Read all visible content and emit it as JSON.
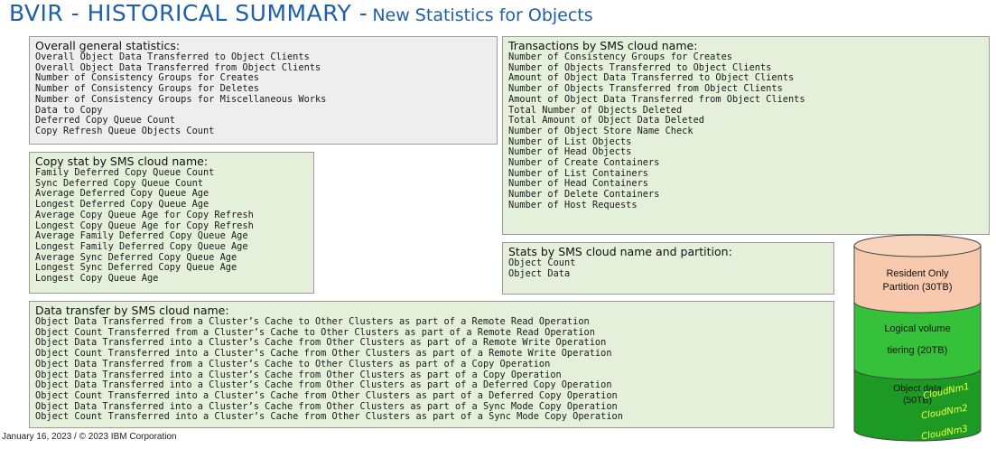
{
  "title": {
    "main": "BVIR - HISTORICAL SUMMARY -",
    "sub": "New Statistics for Objects"
  },
  "overall": {
    "heading": "Overall general statistics:",
    "items": [
      "Overall Object Data Transferred to Object Clients",
      "Overall Object Data Transferred from Object Clients",
      "Number of Consistency Groups for Creates",
      "Number of Consistency Groups for Deletes",
      "Number of Consistency Groups for Miscellaneous Works",
      "Data to Copy",
      "Deferred Copy Queue Count",
      "Copy Refresh Queue Objects Count"
    ]
  },
  "copy_stat": {
    "heading": "Copy stat by SMS cloud name:",
    "items": [
      "Family Deferred Copy Queue Count",
      "Sync Deferred Copy Queue Count",
      "Average Deferred Copy Queue Age",
      "Longest Deferred Copy Queue Age",
      "Average Copy Queue Age for Copy Refresh",
      "Longest Copy Queue Age for Copy Refresh",
      "Average Family Deferred Copy Queue Age",
      "Longest Family Deferred Copy Queue Age",
      "Average Sync Deferred Copy Queue Age",
      "Longest Sync Deferred Copy Queue Age",
      "Longest Copy Queue Age"
    ]
  },
  "transactions": {
    "heading": "Transactions by SMS cloud name:",
    "items": [
      "Number of Consistency Groups for Creates",
      "Number of Objects Transferred to Object Clients",
      "Amount of Object Data Transferred to Object Clients",
      "Number of Objects Transferred from Object Clients",
      "Amount of Object Data Transferred from Object Clients",
      "Total Number of Objects Deleted",
      "Total Amount of Object Data Deleted",
      "Number of Object Store Name Check",
      "Number of List Objects",
      "Number of Head Objects",
      "Number of Create Containers",
      "Number of List Containers",
      "Number of Head Containers",
      "Number of Delete Containers",
      "Number of Host Requests"
    ]
  },
  "partition_stats": {
    "heading": "Stats by SMS cloud name and partition:",
    "items": [
      "Object Count",
      "Object Data"
    ]
  },
  "data_transfer": {
    "heading": "Data transfer by SMS cloud name:",
    "items": [
      "Object Data Transferred from a Cluster’s Cache to Other Clusters as part of a Remote Read Operation",
      "Object Count Transferred from a Cluster’s Cache to Other Clusters as part of a Remote Read Operation",
      "Object Data Transferred into a Cluster’s Cache from Other Clusters as part of a Remote Write Operation",
      "Object Count Transferred into a Cluster’s Cache from Other Clusters as part of a Remote Write Operation",
      "Object Data Transferred from a Cluster’s Cache to Other Clusters as part of a Copy Operation",
      "Object Data Transferred into a Cluster’s Cache from Other Clusters as part of a Copy Operation",
      "Object Data Transferred into a Cluster’s Cache from Other Clusters as part of a Deferred Copy Operation",
      "Object Count Transferred into a Cluster’s Cache from Other Clusters as part of a Deferred Copy Operation",
      "Object Data Transferred into a Cluster’s Cache from Other Clusters as part of a Sync Mode Copy Operation",
      "Object Count Transferred into a Cluster’s Cache from Other Clusters as part of a Sync Mode Copy Operation"
    ]
  },
  "cylinder": {
    "resident": [
      "Resident Only",
      "Partition (30TB)"
    ],
    "logical": "Logical volume",
    "tiering": "tiering (20TB)",
    "object": [
      "Object data",
      "(50TB)"
    ],
    "clouds": [
      "CloudNm1",
      "CloudNm2",
      "CloudNm3"
    ],
    "colors": {
      "resident": "#f8c9ad",
      "logical": "#35c23a",
      "object": "#1c9a24"
    }
  },
  "footer": "January 16, 2023 / © 2023 IBM Corporation"
}
